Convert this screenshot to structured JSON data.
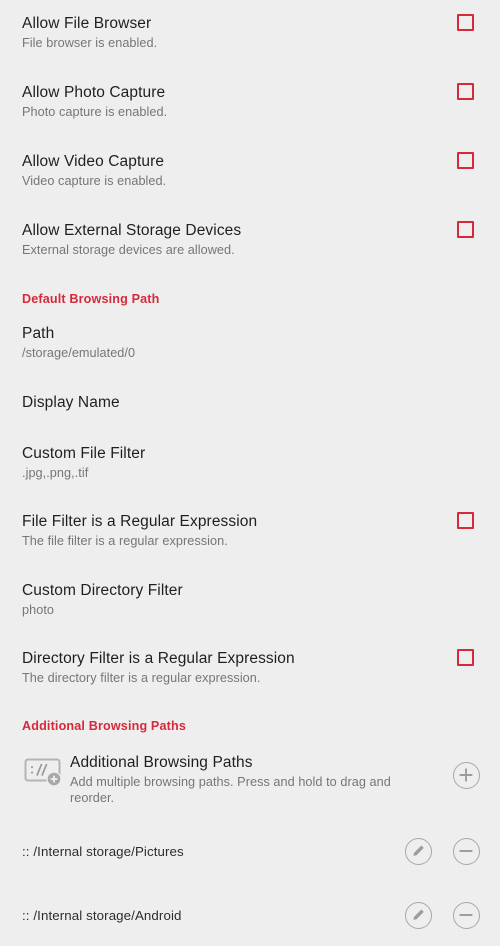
{
  "theme": {
    "background": "#eeeeee",
    "accent": "#d6293b",
    "title_color": "#1f1f1f",
    "summary_color": "#767676",
    "icon_outline": "#a8a8a8"
  },
  "preferences": [
    {
      "title": "Allow File Browser",
      "summary": "File browser is enabled.",
      "control": "checkbox",
      "checked": false
    },
    {
      "title": "Allow Photo Capture",
      "summary": "Photo capture is enabled.",
      "control": "checkbox",
      "checked": false
    },
    {
      "title": "Allow Video Capture",
      "summary": "Video capture is enabled.",
      "control": "checkbox",
      "checked": false
    },
    {
      "title": "Allow External Storage Devices",
      "summary": "External storage devices are allowed.",
      "control": "checkbox",
      "checked": false
    }
  ],
  "default_browsing_path": {
    "header": "Default Browsing Path",
    "items": [
      {
        "title": "Path",
        "summary": "/storage/emulated/0",
        "control": "none"
      },
      {
        "title": "Display Name",
        "summary": "",
        "control": "none"
      },
      {
        "title": "Custom File Filter",
        "summary": ".jpg,.png,.tif",
        "control": "none"
      },
      {
        "title": "File Filter is a Regular Expression",
        "summary": "The file filter is a regular expression.",
        "control": "checkbox",
        "checked": false
      },
      {
        "title": "Custom Directory Filter",
        "summary": "photo",
        "control": "none"
      },
      {
        "title": "Directory Filter is a Regular Expression",
        "summary": "The directory filter is a regular expression.",
        "control": "checkbox",
        "checked": false
      }
    ]
  },
  "additional_browsing_paths": {
    "header": "Additional Browsing Paths",
    "entry": {
      "title": "Additional Browsing Paths",
      "summary": "Add multiple browsing paths. Press and hold to drag and reorder.",
      "leading_icon": "url-path-add-icon",
      "action_icon": "plus-circle-icon"
    },
    "paths": [
      {
        "label": ":: /Internal storage/Pictures",
        "edit_icon": "pencil-circle-icon",
        "remove_icon": "minus-circle-icon"
      },
      {
        "label": ":: /Internal storage/Android",
        "edit_icon": "pencil-circle-icon",
        "remove_icon": "minus-circle-icon"
      }
    ]
  }
}
